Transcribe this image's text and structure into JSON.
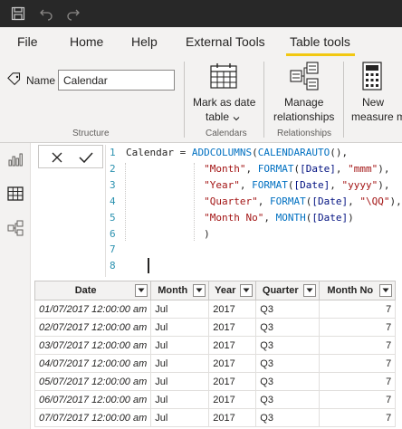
{
  "titlebar": {
    "icons": [
      "save-icon",
      "undo-icon",
      "redo-icon"
    ]
  },
  "tabs": [
    {
      "label": "File"
    },
    {
      "label": "Home"
    },
    {
      "label": "Help"
    },
    {
      "label": "External Tools"
    },
    {
      "label": "Table tools",
      "active": true
    }
  ],
  "ribbon": {
    "name_label": "Name",
    "name_value": "Calendar",
    "structure_label": "Structure",
    "mark_date_line1": "Mark as date",
    "mark_date_line2": "table",
    "calendars_label": "Calendars",
    "manage_line1": "Manage",
    "manage_line2": "relationships",
    "relationships_label": "Relationships",
    "new_line1": "New",
    "new_line2": "measure m"
  },
  "formula": {
    "line_numbers": [
      "1",
      "2",
      "3",
      "4",
      "5",
      "6",
      "7",
      "8"
    ],
    "lines": [
      [
        {
          "t": "Calendar = ",
          "c": ""
        },
        {
          "t": "ADDCOLUMNS",
          "c": "kw"
        },
        {
          "t": "(",
          "c": ""
        },
        {
          "t": "CALENDARAUTO",
          "c": "kw"
        },
        {
          "t": "(),",
          "c": ""
        }
      ],
      [
        {
          "t": "             ",
          "c": ""
        },
        {
          "t": "\"Month\"",
          "c": "str"
        },
        {
          "t": ", ",
          "c": ""
        },
        {
          "t": "FORMAT",
          "c": "kw"
        },
        {
          "t": "(",
          "c": ""
        },
        {
          "t": "[Date]",
          "c": "fld"
        },
        {
          "t": ", ",
          "c": ""
        },
        {
          "t": "\"mmm\"",
          "c": "str"
        },
        {
          "t": "),",
          "c": ""
        }
      ],
      [
        {
          "t": "             ",
          "c": ""
        },
        {
          "t": "\"Year\"",
          "c": "str"
        },
        {
          "t": ", ",
          "c": ""
        },
        {
          "t": "FORMAT",
          "c": "kw"
        },
        {
          "t": "(",
          "c": ""
        },
        {
          "t": "[Date]",
          "c": "fld"
        },
        {
          "t": ", ",
          "c": ""
        },
        {
          "t": "\"yyyy\"",
          "c": "str"
        },
        {
          "t": "),",
          "c": ""
        }
      ],
      [
        {
          "t": "             ",
          "c": ""
        },
        {
          "t": "\"Quarter\"",
          "c": "str"
        },
        {
          "t": ", ",
          "c": ""
        },
        {
          "t": "FORMAT",
          "c": "kw"
        },
        {
          "t": "(",
          "c": ""
        },
        {
          "t": "[Date]",
          "c": "fld"
        },
        {
          "t": ", ",
          "c": ""
        },
        {
          "t": "\"\\QQ\"",
          "c": "str"
        },
        {
          "t": "),",
          "c": ""
        }
      ],
      [
        {
          "t": "             ",
          "c": ""
        },
        {
          "t": "\"Month No\"",
          "c": "str"
        },
        {
          "t": ", ",
          "c": ""
        },
        {
          "t": "MONTH",
          "c": "kw"
        },
        {
          "t": "(",
          "c": ""
        },
        {
          "t": "[Date]",
          "c": "fld"
        },
        {
          "t": ")",
          "c": ""
        }
      ],
      [
        {
          "t": "             )",
          "c": ""
        }
      ],
      [
        {
          "t": "",
          "c": ""
        }
      ],
      [
        {
          "t": "",
          "c": ""
        }
      ]
    ]
  },
  "table": {
    "columns": [
      "Date",
      "Month",
      "Year",
      "Quarter",
      "Month No"
    ],
    "rows": [
      [
        "01/07/2017 12:00:00 am",
        "Jul",
        "2017",
        "Q3",
        "7"
      ],
      [
        "02/07/2017 12:00:00 am",
        "Jul",
        "2017",
        "Q3",
        "7"
      ],
      [
        "03/07/2017 12:00:00 am",
        "Jul",
        "2017",
        "Q3",
        "7"
      ],
      [
        "04/07/2017 12:00:00 am",
        "Jul",
        "2017",
        "Q3",
        "7"
      ],
      [
        "05/07/2017 12:00:00 am",
        "Jul",
        "2017",
        "Q3",
        "7"
      ],
      [
        "06/07/2017 12:00:00 am",
        "Jul",
        "2017",
        "Q3",
        "7"
      ],
      [
        "07/07/2017 12:00:00 am",
        "Jul",
        "2017",
        "Q3",
        "7"
      ]
    ]
  },
  "colors": {
    "titlebar": "#282828",
    "ribbon": "#f3f2f1",
    "accent": "#f2c811",
    "keyword": "#0070c1",
    "string": "#a31515",
    "line_number": "#2b91af"
  }
}
